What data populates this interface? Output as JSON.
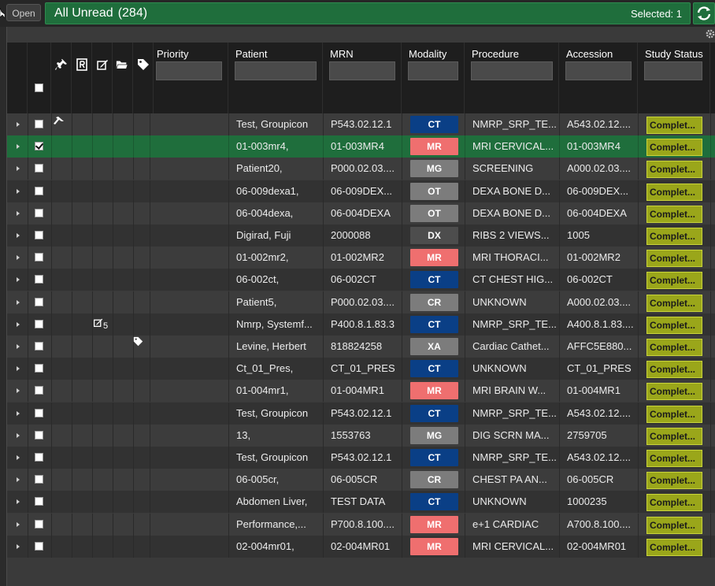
{
  "toolbar": {
    "open_label": "Open",
    "worklist_title": "All Unread",
    "worklist_count": "(284)",
    "selected_text": "Selected: 1"
  },
  "columns": {
    "priority": "Priority",
    "patient": "Patient",
    "mrn": "MRN",
    "modality": "Modality",
    "procedure": "Procedure",
    "accession": "Accession",
    "status": "Study Status"
  },
  "modality_colors": {
    "CT": "#0a3f86",
    "MR": "#ef6f6f",
    "MG": "#7c7c7c",
    "OT": "#7c7c7c",
    "DX": "#4d4d4d",
    "CR": "#7c7c7c",
    "XA": "#7c7c7c"
  },
  "rows": [
    {
      "patient": "Test, Groupicon",
      "mrn": "P543.02.12.1",
      "modality": "CT",
      "procedure": "NMRP_SRP_TE...",
      "accession": "A543.02.12....",
      "status": "Complet...",
      "checked": false,
      "selected": false,
      "icon": "pin"
    },
    {
      "patient": "01-003mr4,",
      "mrn": "01-003MR4",
      "modality": "MR",
      "procedure": "MRI CERVICAL...",
      "accession": "01-003MR4",
      "status": "Complet...",
      "checked": true,
      "selected": true,
      "icon": ""
    },
    {
      "patient": "Patient20,",
      "mrn": "P000.02.03....",
      "modality": "MG",
      "procedure": "SCREENING",
      "accession": "A000.02.03....",
      "status": "Complet...",
      "checked": false,
      "selected": false,
      "icon": ""
    },
    {
      "patient": "06-009dexa1,",
      "mrn": "06-009DEX...",
      "modality": "OT",
      "procedure": "DEXA BONE D...",
      "accession": "06-009DEX...",
      "status": "Complet...",
      "checked": false,
      "selected": false,
      "icon": ""
    },
    {
      "patient": "06-004dexa,",
      "mrn": "06-004DEXA",
      "modality": "OT",
      "procedure": "DEXA BONE D...",
      "accession": "06-004DEXA",
      "status": "Complet...",
      "checked": false,
      "selected": false,
      "icon": ""
    },
    {
      "patient": "Digirad, Fuji",
      "mrn": "2000088",
      "modality": "DX",
      "procedure": "RIBS 2 VIEWS...",
      "accession": "1005",
      "status": "Complet...",
      "checked": false,
      "selected": false,
      "icon": ""
    },
    {
      "patient": "01-002mr2,",
      "mrn": "01-002MR2",
      "modality": "MR",
      "procedure": "MRI THORACI...",
      "accession": "01-002MR2",
      "status": "Complet...",
      "checked": false,
      "selected": false,
      "icon": ""
    },
    {
      "patient": "06-002ct,",
      "mrn": "06-002CT",
      "modality": "CT",
      "procedure": "CT CHEST HIG...",
      "accession": "06-002CT",
      "status": "Complet...",
      "checked": false,
      "selected": false,
      "icon": ""
    },
    {
      "patient": "Patient5,",
      "mrn": "P000.02.03....",
      "modality": "CR",
      "procedure": "UNKNOWN",
      "accession": "A000.02.03....",
      "status": "Complet...",
      "checked": false,
      "selected": false,
      "icon": ""
    },
    {
      "patient": "Nmrp, Systemf...",
      "mrn": "P400.8.1.83.3",
      "modality": "CT",
      "procedure": "NMRP_SRP_TE...",
      "accession": "A400.8.1.83....",
      "status": "Complet...",
      "checked": false,
      "selected": false,
      "icon": "note",
      "note_count": "5"
    },
    {
      "patient": "Levine, Herbert",
      "mrn": "818824258",
      "modality": "XA",
      "procedure": "Cardiac Cathet...",
      "accession": "AFFC5E880...",
      "status": "Complet...",
      "checked": false,
      "selected": false,
      "icon": "tag"
    },
    {
      "patient": "Ct_01_Pres,",
      "mrn": "CT_01_PRES",
      "modality": "CT",
      "procedure": "UNKNOWN",
      "accession": "CT_01_PRES",
      "status": "Complet...",
      "checked": false,
      "selected": false,
      "icon": ""
    },
    {
      "patient": "01-004mr1,",
      "mrn": "01-004MR1",
      "modality": "MR",
      "procedure": "MRI BRAIN W...",
      "accession": "01-004MR1",
      "status": "Complet...",
      "checked": false,
      "selected": false,
      "icon": ""
    },
    {
      "patient": "Test, Groupicon",
      "mrn": "P543.02.12.1",
      "modality": "CT",
      "procedure": "NMRP_SRP_TE...",
      "accession": "A543.02.12....",
      "status": "Complet...",
      "checked": false,
      "selected": false,
      "icon": ""
    },
    {
      "patient": "13,",
      "mrn": "1553763",
      "modality": "MG",
      "procedure": "DIG SCRN MA...",
      "accession": "2759705",
      "status": "Complet...",
      "checked": false,
      "selected": false,
      "icon": ""
    },
    {
      "patient": "Test, Groupicon",
      "mrn": "P543.02.12.1",
      "modality": "CT",
      "procedure": "NMRP_SRP_TE...",
      "accession": "A543.02.12....",
      "status": "Complet...",
      "checked": false,
      "selected": false,
      "icon": ""
    },
    {
      "patient": "06-005cr,",
      "mrn": "06-005CR",
      "modality": "CR",
      "procedure": "CHEST PA AN...",
      "accession": "06-005CR",
      "status": "Complet...",
      "checked": false,
      "selected": false,
      "icon": ""
    },
    {
      "patient": "Abdomen Liver,",
      "mrn": "TEST DATA",
      "modality": "CT",
      "procedure": "UNKNOWN",
      "accession": "1000235",
      "status": "Complet...",
      "checked": false,
      "selected": false,
      "icon": ""
    },
    {
      "patient": "Performance,...",
      "mrn": "P700.8.100....",
      "modality": "MR",
      "procedure": "e+1 CARDIAC",
      "accession": "A700.8.100....",
      "status": "Complet...",
      "checked": false,
      "selected": false,
      "icon": ""
    },
    {
      "patient": "02-004mr01,",
      "mrn": "02-004MR01",
      "modality": "MR",
      "procedure": "MRI CERVICAL...",
      "accession": "02-004MR01",
      "status": "Complet...",
      "checked": false,
      "selected": false,
      "icon": ""
    }
  ]
}
